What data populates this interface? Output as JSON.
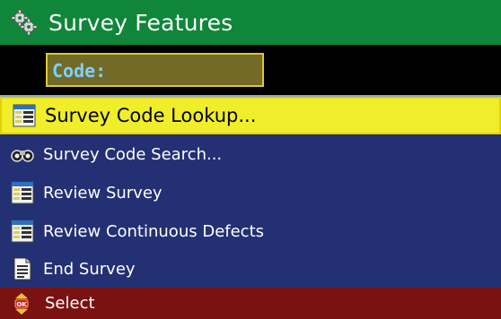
{
  "header": {
    "title": "Survey Features",
    "icon": "gears-icon"
  },
  "code": {
    "label": "Code:"
  },
  "menu": {
    "items": [
      {
        "label": "Survey Code Lookup...",
        "icon": "code-list-icon",
        "selected": true
      },
      {
        "label": "Survey Code Search...",
        "icon": "binoculars-icon"
      },
      {
        "label": "Review Survey",
        "icon": "code-list-icon"
      },
      {
        "label": "Review Continuous Defects",
        "icon": "code-list-icon"
      },
      {
        "label": "End Survey",
        "icon": "document-icon"
      }
    ]
  },
  "footer": {
    "label": "Select",
    "ok_text": "OK",
    "icon": "ok-updown-icon"
  },
  "colors": {
    "header_bg": "#10863a",
    "menu_bg": "#243074",
    "selected_bg": "#f0ee2a",
    "footer_bg": "#7b1212",
    "code_bg": "#726a26",
    "code_text": "#7fd0ff"
  }
}
